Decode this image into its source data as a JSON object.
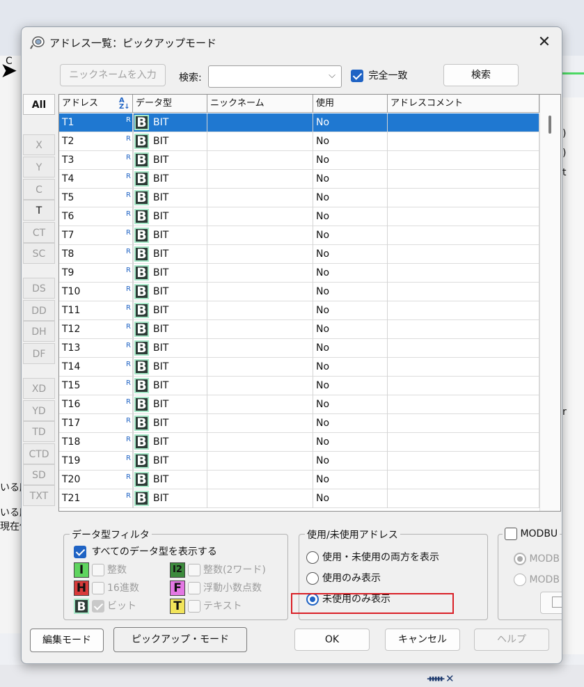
{
  "window": {
    "title": "アドレス一覧：ピックアップモード",
    "close": "✕"
  },
  "toolbar": {
    "nickname_button": "ニックネームを入力",
    "search_label": "検索:",
    "search_value": "",
    "exact_match_label": "完全一致",
    "exact_match_checked": true,
    "search_button": "検索"
  },
  "tabs": [
    "All",
    "X",
    "Y",
    "C",
    "T",
    "CT",
    "SC",
    "DS",
    "DD",
    "DH",
    "DF",
    "XD",
    "YD",
    "TD",
    "CTD",
    "SD",
    "TXT"
  ],
  "active_tab": "All",
  "table": {
    "columns": [
      "アドレス",
      "データ型",
      "ニックネーム",
      "使用",
      "アドレスコメント"
    ],
    "sort_icon": "A↓Z",
    "rows": [
      {
        "address": "T1",
        "r": "R",
        "type_icon": "B",
        "type": "BIT",
        "nickname": "",
        "used": "No",
        "comment": ""
      },
      {
        "address": "T2",
        "r": "R",
        "type_icon": "B",
        "type": "BIT",
        "nickname": "",
        "used": "No",
        "comment": ""
      },
      {
        "address": "T3",
        "r": "R",
        "type_icon": "B",
        "type": "BIT",
        "nickname": "",
        "used": "No",
        "comment": ""
      },
      {
        "address": "T4",
        "r": "R",
        "type_icon": "B",
        "type": "BIT",
        "nickname": "",
        "used": "No",
        "comment": ""
      },
      {
        "address": "T5",
        "r": "R",
        "type_icon": "B",
        "type": "BIT",
        "nickname": "",
        "used": "No",
        "comment": ""
      },
      {
        "address": "T6",
        "r": "R",
        "type_icon": "B",
        "type": "BIT",
        "nickname": "",
        "used": "No",
        "comment": ""
      },
      {
        "address": "T7",
        "r": "R",
        "type_icon": "B",
        "type": "BIT",
        "nickname": "",
        "used": "No",
        "comment": ""
      },
      {
        "address": "T8",
        "r": "R",
        "type_icon": "B",
        "type": "BIT",
        "nickname": "",
        "used": "No",
        "comment": ""
      },
      {
        "address": "T9",
        "r": "R",
        "type_icon": "B",
        "type": "BIT",
        "nickname": "",
        "used": "No",
        "comment": ""
      },
      {
        "address": "T10",
        "r": "R",
        "type_icon": "B",
        "type": "BIT",
        "nickname": "",
        "used": "No",
        "comment": ""
      },
      {
        "address": "T11",
        "r": "R",
        "type_icon": "B",
        "type": "BIT",
        "nickname": "",
        "used": "No",
        "comment": ""
      },
      {
        "address": "T12",
        "r": "R",
        "type_icon": "B",
        "type": "BIT",
        "nickname": "",
        "used": "No",
        "comment": ""
      },
      {
        "address": "T13",
        "r": "R",
        "type_icon": "B",
        "type": "BIT",
        "nickname": "",
        "used": "No",
        "comment": ""
      },
      {
        "address": "T14",
        "r": "R",
        "type_icon": "B",
        "type": "BIT",
        "nickname": "",
        "used": "No",
        "comment": ""
      },
      {
        "address": "T15",
        "r": "R",
        "type_icon": "B",
        "type": "BIT",
        "nickname": "",
        "used": "No",
        "comment": ""
      },
      {
        "address": "T16",
        "r": "R",
        "type_icon": "B",
        "type": "BIT",
        "nickname": "",
        "used": "No",
        "comment": ""
      },
      {
        "address": "T17",
        "r": "R",
        "type_icon": "B",
        "type": "BIT",
        "nickname": "",
        "used": "No",
        "comment": ""
      },
      {
        "address": "T18",
        "r": "R",
        "type_icon": "B",
        "type": "BIT",
        "nickname": "",
        "used": "No",
        "comment": ""
      },
      {
        "address": "T19",
        "r": "R",
        "type_icon": "B",
        "type": "BIT",
        "nickname": "",
        "used": "No",
        "comment": ""
      },
      {
        "address": "T20",
        "r": "R",
        "type_icon": "B",
        "type": "BIT",
        "nickname": "",
        "used": "No",
        "comment": ""
      },
      {
        "address": "T21",
        "r": "R",
        "type_icon": "B",
        "type": "BIT",
        "nickname": "",
        "used": "No",
        "comment": ""
      }
    ],
    "selected_row": 0
  },
  "type_filter": {
    "legend": "データ型フィルタ",
    "show_all_label": "すべてのデータ型を表示する",
    "items": [
      {
        "icon": "I",
        "label": "整数",
        "color": "#5ed45e"
      },
      {
        "icon": "I2",
        "label": "整数(2ワード)",
        "color": "#3c8a3c"
      },
      {
        "icon": "H",
        "label": "16進数",
        "color": "#d83a3a"
      },
      {
        "icon": "F",
        "label": "浮動小数点数",
        "color": "#e477e4"
      },
      {
        "icon": "B",
        "label": "ビット",
        "color": "#2c3b36"
      },
      {
        "icon": "T",
        "label": "テキスト",
        "color": "#f2e45a"
      }
    ]
  },
  "usage_filter": {
    "legend": "使用/未使用アドレス",
    "options": [
      "使用・未使用の両方を表示",
      "使用のみ表示",
      "未使用のみ表示"
    ],
    "selected": 2
  },
  "modbus": {
    "label": "MODBU",
    "options": [
      "MODB",
      "MODB"
    ]
  },
  "buttons": {
    "edit_mode": "編集モード",
    "pickup_mode": "ピックアップ・モード",
    "ok": "OK",
    "cancel": "キャンセル",
    "help": "ヘルプ"
  },
  "background": {
    "c_label": "C",
    "left_text_1": "いる所",
    "left_text_2": "いる所",
    "left_text_3": "現在値",
    "right_text_1": ")",
    "right_text_2": ")",
    "right_text_3": "t",
    "right_text_4": "r",
    "pin": "📌",
    "close": "✕"
  },
  "colors": {
    "accent": "#1f63c4",
    "selection": "#1f78d1",
    "highlight": "#d91f26"
  }
}
